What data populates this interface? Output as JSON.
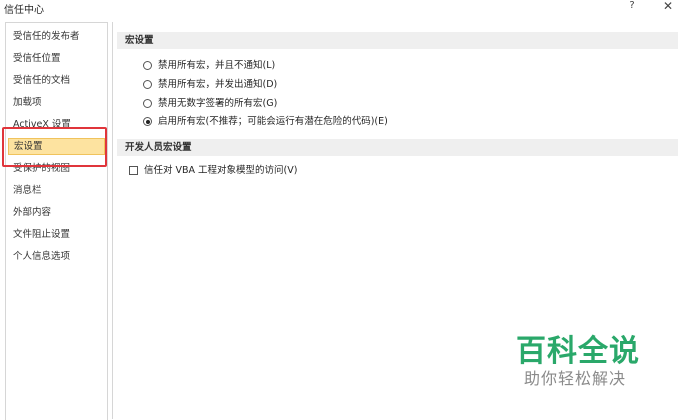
{
  "window": {
    "title": "信任中心",
    "help_label": "?",
    "close_label": "✕"
  },
  "sidebar": {
    "items": [
      {
        "label": "受信任的发布者"
      },
      {
        "label": "受信任位置"
      },
      {
        "label": "受信任的文档"
      },
      {
        "label": "加载项"
      },
      {
        "label": "ActiveX 设置"
      },
      {
        "label": "宏设置"
      },
      {
        "label": "受保护的视图"
      },
      {
        "label": "消息栏"
      },
      {
        "label": "外部内容"
      },
      {
        "label": "文件阻止设置"
      },
      {
        "label": "个人信息选项"
      }
    ],
    "selected": "宏设置"
  },
  "macro_section": {
    "header": "宏设置",
    "options": [
      {
        "label": "禁用所有宏，并且不通知(L)",
        "checked": false
      },
      {
        "label": "禁用所有宏，并发出通知(D)",
        "checked": false
      },
      {
        "label": "禁用无数字签署的所有宏(G)",
        "checked": false
      },
      {
        "label": "启用所有宏(不推荐；可能会运行有潜在危险的代码)(E)",
        "checked": true
      }
    ]
  },
  "developer_section": {
    "header": "开发人员宏设置",
    "vba_access_label": "信任对 VBA 工程对象模型的访问(V)",
    "vba_access_checked": false
  },
  "watermark": {
    "title": "百科全说",
    "subtitle": "助你轻松解决"
  },
  "colors": {
    "selected_bg": "#fde3a0",
    "highlight_box": "#e0353b",
    "watermark_green": "#2aa86a"
  }
}
